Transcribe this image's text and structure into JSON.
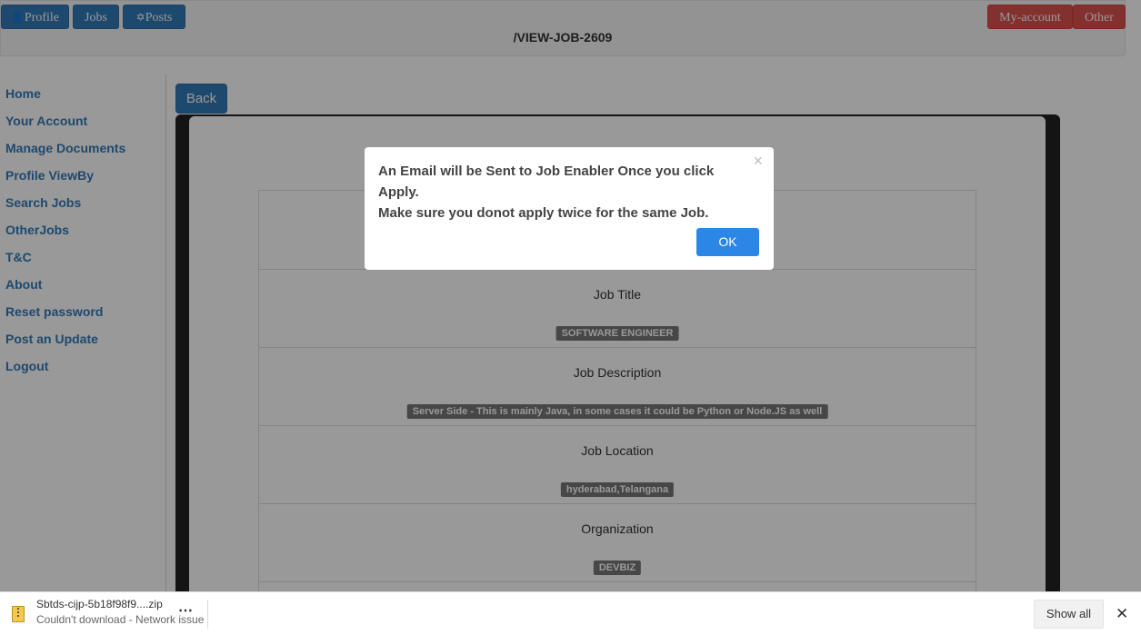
{
  "header": {
    "nav_left": [
      {
        "label": "Profile",
        "icon": "user-icon"
      },
      {
        "label": "Jobs"
      },
      {
        "label": "Posts",
        "icon": "move-icon"
      }
    ],
    "nav_right": [
      {
        "label": "My-account"
      },
      {
        "label": "Other"
      }
    ],
    "title": "/VIEW-JOB-2609"
  },
  "sidebar": {
    "items": [
      "Home",
      "Your Account",
      "Manage Documents",
      "Profile ViewBy",
      "Search Jobs",
      "OtherJobs",
      "T&C",
      "About",
      "Reset password",
      "Post an Update",
      "Logout"
    ]
  },
  "main": {
    "back_label": "Back",
    "fields": [
      {
        "label": "Job Title",
        "value": "SOFTWARE ENGINEER"
      },
      {
        "label": "Job Description",
        "value": "Server Side - This is mainly Java, in some cases it could be Python or Node.JS as well"
      },
      {
        "label": "Job Location",
        "value": "hyderabad,Telangana"
      },
      {
        "label": "Organization",
        "value": "DEVBIZ"
      }
    ]
  },
  "modal": {
    "line1": "An Email will be Sent to Job Enabler Once you click Apply.",
    "line2": "Make sure you donot apply twice for the same Job.",
    "ok_label": "OK",
    "close_symbol": "×"
  },
  "download_bar": {
    "file_name": "Sbtds-cijp-5b18f98f9....zip",
    "status": "Couldn't download - Network issue",
    "show_all": "Show all"
  },
  "colors": {
    "primary_blue": "#337ab7",
    "danger_red": "#d9534f",
    "ok_blue": "#2b86e6"
  }
}
